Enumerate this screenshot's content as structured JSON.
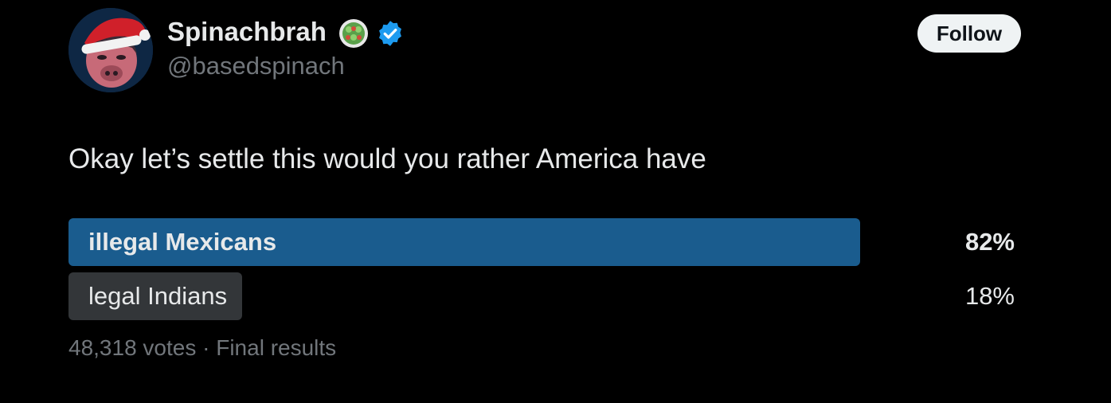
{
  "author": {
    "display_name": "Spinachbrah",
    "handle": "@basedspinach",
    "name_emoji": "salad-bowl-icon",
    "verified": true
  },
  "follow_button": {
    "label": "Follow"
  },
  "tweet": {
    "text": "Okay let’s settle this would you rather America have"
  },
  "poll": {
    "options": [
      {
        "label": "illegal Mexicans",
        "percent_text": "82%",
        "percent": 82,
        "winner": true
      },
      {
        "label": "legal Indians",
        "percent_text": "18%",
        "percent": 18,
        "winner": false
      }
    ],
    "votes": "48,318 votes",
    "separator": " · ",
    "status": "Final results"
  },
  "colors": {
    "background": "#000000",
    "winner_bar": "#1a5c8e",
    "loser_bar": "#333639",
    "secondary_text": "#71767b",
    "verified_blue": "#1d9bf0"
  }
}
